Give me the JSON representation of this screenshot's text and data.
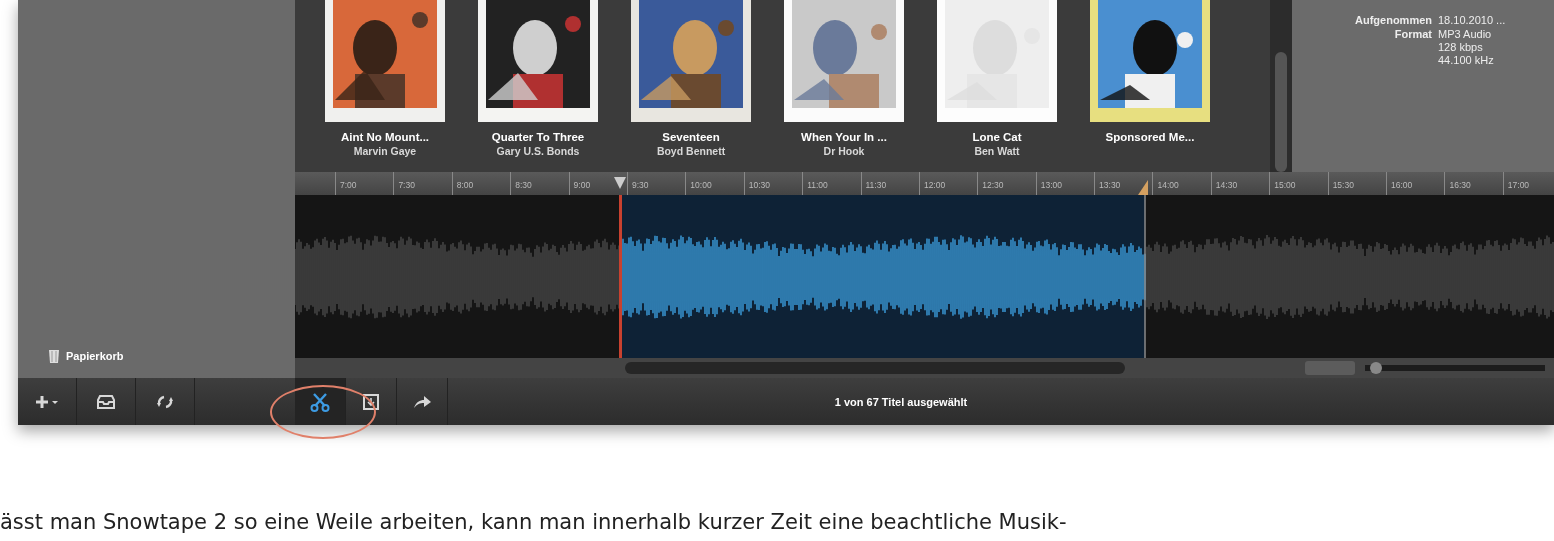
{
  "sidebar": {
    "trash_label": "Papierkorb"
  },
  "albums": [
    {
      "title": "Aint No Mount...",
      "artist": "Marvin Gaye"
    },
    {
      "title": "Quarter To Three",
      "artist": "Gary U.S. Bonds"
    },
    {
      "title": "Seventeen",
      "artist": "Boyd Bennett"
    },
    {
      "title": "When Your In ...",
      "artist": "Dr Hook"
    },
    {
      "title": "Lone Cat",
      "artist": "Ben Watt"
    },
    {
      "title": "Sponsored Me..."
    }
  ],
  "info": [
    {
      "label": "Aufgenommen",
      "values": [
        "18.10.2010 ..."
      ]
    },
    {
      "label": "Format",
      "values": [
        "MP3 Audio",
        "128 kbps",
        "44.100 kHz"
      ]
    }
  ],
  "ruler": [
    "7:00",
    "7:30",
    "8:00",
    "8:30",
    "9:00",
    "9:30",
    "10:00",
    "10:30",
    "11:00",
    "11:30",
    "12:00",
    "12:30",
    "13:00",
    "13:30",
    "14:00",
    "14:30",
    "15:00",
    "15:30",
    "16:00",
    "16:30",
    "17:00"
  ],
  "zoom_slider": {
    "level": 0.03
  },
  "toolbar_left": [
    {
      "kind": "add"
    },
    {
      "kind": "tray"
    },
    {
      "kind": "sync"
    }
  ],
  "toolbar_tools": [
    {
      "kind": "scissors",
      "selected": true
    },
    {
      "kind": "export",
      "selected": false
    },
    {
      "kind": "share",
      "selected": false
    }
  ],
  "status": "1 von 67 Titel ausgewählt",
  "article_text": "ässt man Snowtape 2 so eine Weile arbeiten, kann man innerhalb kurzer Zeit eine beachtliche Musik-"
}
